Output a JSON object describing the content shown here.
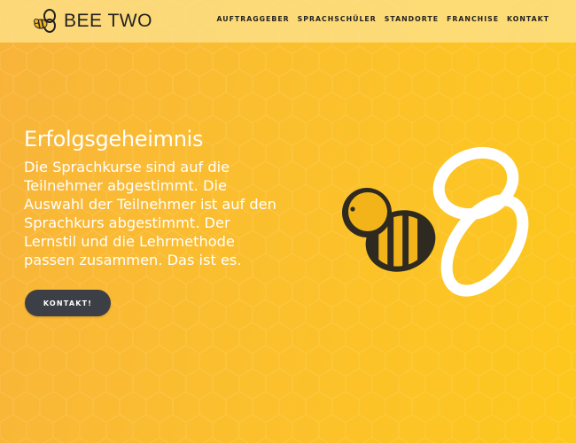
{
  "brand": {
    "name": "BEE TWO",
    "colors": {
      "background": "#fbbf2e",
      "header": "#fce28c",
      "text": "#ffffff",
      "button": "#3d3f46",
      "bee_body": "#2f2a1f",
      "bee_stripe": "#f2b418"
    }
  },
  "nav": {
    "items": [
      {
        "label": "AUFTRAGGEBER"
      },
      {
        "label": "SPRACHSCHÜLER"
      },
      {
        "label": "STANDORTE"
      },
      {
        "label": "FRANCHISE"
      },
      {
        "label": "KONTAKT"
      }
    ]
  },
  "hero": {
    "title": "Erfolgsgeheimnis",
    "lines": [
      "Die Sprachkurse sind auf die",
      "Teilnehmer abgestimmt. Die",
      "Auswahl der Teilnehmer ist auf den",
      "Sprachkurs abgestimmt. Der",
      "Lernstil und die Lehrmethode",
      "passen zusammen. Das ist es."
    ],
    "button_label": "KONTAKT!"
  },
  "icons": {
    "logo": "bee-logo-icon",
    "illustration": "bee-illustration-icon"
  }
}
